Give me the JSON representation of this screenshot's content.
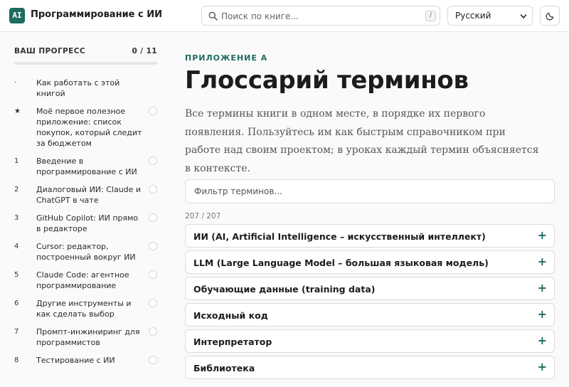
{
  "header": {
    "logo_text": "AI",
    "brand": "Программирование с ИИ",
    "search_placeholder": "Поиск по книге...",
    "search_shortcut": "/",
    "language": "Русский",
    "theme_icon": "moon-icon"
  },
  "sidebar": {
    "progress_title": "ВАШ ПРОГРЕСС",
    "progress_count": "0 / 11",
    "progress_fraction": 0,
    "items": [
      {
        "num": "·",
        "label": "Как работать с этой книгой",
        "check": false
      },
      {
        "num": "★",
        "label": "Моё первое полезное приложение: список покупок, который следит за бюджетом",
        "check": true
      },
      {
        "num": "1",
        "label": "Введение в программирование с ИИ",
        "check": true
      },
      {
        "num": "2",
        "label": "Диалоговый ИИ: Claude и ChatGPT в чате",
        "check": true
      },
      {
        "num": "3",
        "label": "GitHub Copilot: ИИ прямо в редакторе",
        "check": true
      },
      {
        "num": "4",
        "label": "Cursor: редактор, построенный вокруг ИИ",
        "check": true
      },
      {
        "num": "5",
        "label": "Claude Code: агентное программирование",
        "check": true
      },
      {
        "num": "6",
        "label": "Другие инструменты и как сделать выбор",
        "check": true
      },
      {
        "num": "7",
        "label": "Промпт-инжиниринг для программистов",
        "check": true
      },
      {
        "num": "8",
        "label": "Тестирование с ИИ",
        "check": true
      }
    ]
  },
  "main": {
    "eyebrow": "ПРИЛОЖЕНИЕ A",
    "title": "Глоссарий терминов",
    "lead": "Все термины книги в одном месте, в порядке их первого появления. Пользуйтесь им как быстрым справочником при работе над своим проектом; в уроках каждый термин объясняется в контексте.",
    "filter_placeholder": "Фильтр терминов...",
    "count": "207 / 207",
    "expand_symbol": "+",
    "terms": [
      "ИИ (AI, Artificial Intelligence – искусственный интеллект)",
      "LLM (Large Language Model – большая языковая модель)",
      "Обучающие данные (training data)",
      "Исходный код",
      "Интерпретатор",
      "Библиотека"
    ]
  },
  "colors": {
    "accent": "#1f6b63",
    "background": "#fafafa"
  }
}
